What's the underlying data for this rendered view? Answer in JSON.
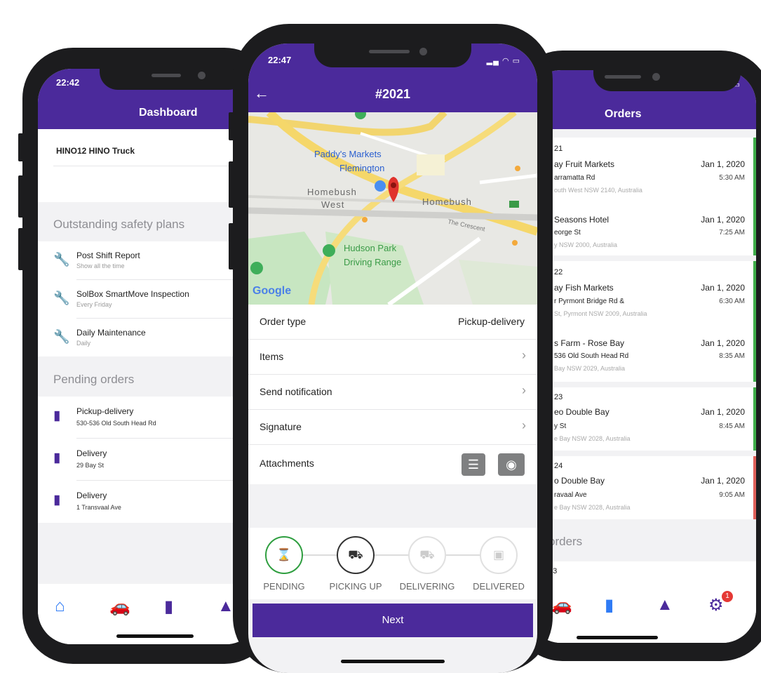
{
  "dashboard": {
    "time": "22:42",
    "title": "Dashboard",
    "vehicle": "HINO12 HINO Truck",
    "safety_section": "Outstanding safety plans",
    "safety_items": [
      {
        "title": "Post Shift Report",
        "subtitle": "Show all the time",
        "icon": "wrench-icon"
      },
      {
        "title": "SolBox SmartMove Inspection",
        "subtitle": "Every Friday",
        "icon": "wrench-icon"
      },
      {
        "title": "Daily Maintenance",
        "subtitle": "Daily",
        "icon": "wrench-icon"
      }
    ],
    "pending_section": "Pending orders",
    "pending_items": [
      {
        "title": "Pickup-delivery",
        "subtitle": "530-536 Old South Head Rd",
        "icon": "document-icon"
      },
      {
        "title": "Delivery",
        "subtitle": "29 Bay St",
        "icon": "document-icon"
      },
      {
        "title": "Delivery",
        "subtitle": "1 Transvaal Ave",
        "icon": "document-icon"
      }
    ],
    "tabs": [
      "home-icon",
      "car-icon",
      "document-icon",
      "navigation-icon"
    ]
  },
  "detail": {
    "time": "22:47",
    "title": "#2021",
    "back_icon": "back-arrow-icon",
    "map_labels": {
      "markets": "Paddy's Markets",
      "flemington": "Flemington",
      "homebush_west_1": "Homebush",
      "homebush_west_2": "West",
      "homebush": "Homebush",
      "hudson_1": "Hudson Park",
      "hudson_2": "Driving Range",
      "crescent": "The Crescent",
      "google": "Google"
    },
    "rows": {
      "order_type_label": "Order type",
      "order_type_value": "Pickup-delivery",
      "items": "Items",
      "send_notification": "Send notification",
      "signature": "Signature",
      "attachments": "Attachments"
    },
    "steps": [
      {
        "label": "PENDING",
        "icon": "hourglass-icon",
        "state": "done",
        "color": "#2e9e3f"
      },
      {
        "label": "PICKING UP",
        "icon": "truck-loading-icon",
        "state": "current",
        "color": "#333333"
      },
      {
        "label": "DELIVERING",
        "icon": "truck-icon",
        "state": "todo",
        "color": "#cccccc"
      },
      {
        "label": "DELIVERED",
        "icon": "package-icon",
        "state": "todo",
        "color": "#cccccc"
      }
    ],
    "next_label": "Next"
  },
  "orders": {
    "title": "Orders",
    "list": [
      {
        "id": "21",
        "name": "ay Fruit Markets",
        "addr": "arramatta Rd",
        "sub": "outh West NSW 2140, Australia",
        "date": "Jan 1, 2020",
        "time": "5:30 AM"
      },
      {
        "id": "",
        "name": "Seasons Hotel",
        "addr": "eorge St",
        "sub": "y NSW 2000, Australia",
        "date": "Jan 1, 2020",
        "time": "7:25 AM"
      },
      {
        "id": "22",
        "name": "ay Fish Markets",
        "addr": "r Pyrmont Bridge Rd &",
        "sub": "St, Pyrmont NSW 2009, Australia",
        "date": "Jan 1, 2020",
        "time": "6:30 AM"
      },
      {
        "id": "",
        "name": "s Farm - Rose Bay",
        "addr": "536 Old South Head Rd",
        "sub": "Bay NSW 2029, Australia",
        "date": "Jan 1, 2020",
        "time": "8:35 AM"
      },
      {
        "id": "23",
        "name": "eo Double Bay",
        "addr": "y St",
        "sub": "e Bay NSW 2028, Australia",
        "date": "Jan 1, 2020",
        "time": "8:45 AM"
      },
      {
        "id": "24",
        "name": "o Double Bay",
        "addr": "ravaal Ave",
        "sub": "e Bay NSW 2028, Australia",
        "date": "Jan 1, 2020",
        "time": "9:05 AM"
      }
    ],
    "completed_section": "orders",
    "partial_id": "03",
    "tabs": [
      "car-icon",
      "document-icon",
      "navigation-icon",
      "settings-icon"
    ],
    "badge": "1",
    "stripe_colors": [
      "#3fae4a",
      "#3fae4a",
      "#3fae4a",
      "#e0605a"
    ]
  }
}
